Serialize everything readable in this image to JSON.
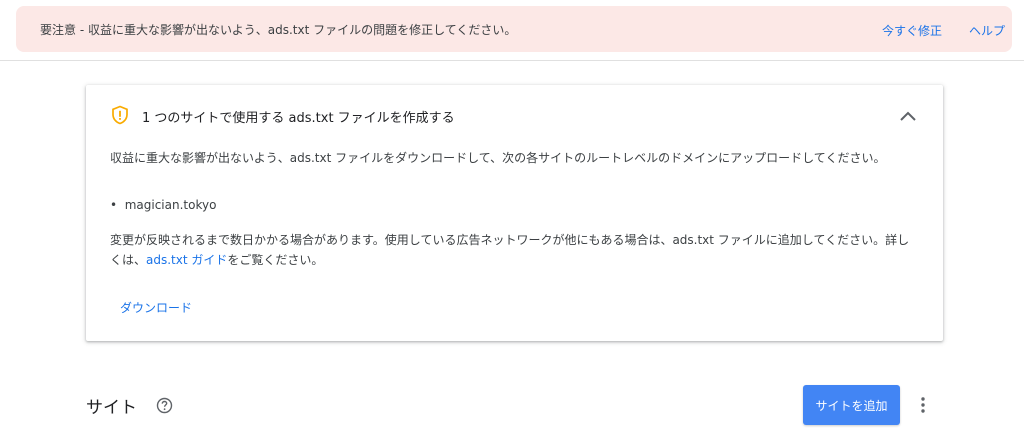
{
  "alert": {
    "message": "要注意 - 収益に重大な影響が出ないよう、ads.txt ファイルの問題を修正してください。",
    "fix_label": "今すぐ修正",
    "help_label": "ヘルプ"
  },
  "card": {
    "icon": "shield-warning-icon",
    "title": "1 つのサイトで使用する ads.txt ファイルを作成する",
    "paragraph1": "収益に重大な影響が出ないよう、ads.txt ファイルをダウンロードして、次の各サイトのルートレベルのドメインにアップロードしてください。",
    "sites": [
      "magician.tokyo"
    ],
    "paragraph2_before": "変更が反映されるまで数日かかる場合があります。使用している広告ネットワークが他にもある場合は、ads.txt ファイルに追加してください。詳しくは、",
    "paragraph2_link": "ads.txt ガイド",
    "paragraph2_after": "をご覧ください。",
    "download_label": "ダウンロード"
  },
  "sites_section": {
    "title": "サイト",
    "add_site_label": "サイトを追加"
  },
  "colors": {
    "alert_bg": "#fce8e6",
    "link": "#1a73e8",
    "warning": "#f9ab00",
    "primary_button": "#4285f4"
  }
}
